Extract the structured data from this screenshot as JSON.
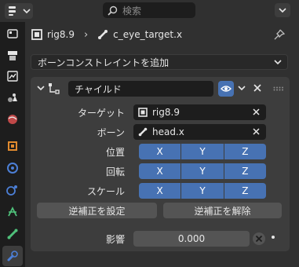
{
  "header": {
    "search_placeholder": "検索"
  },
  "breadcrumb": {
    "armature": "rig8.9",
    "bone": "c_eye_target.x"
  },
  "add_constraint_label": "ボーンコンストレイントを追加",
  "constraint": {
    "name": "チャイルド",
    "target_label": "ターゲット",
    "target_value": "rig8.9",
    "bone_label": "ボーン",
    "bone_value": "head.x",
    "location_label": "位置",
    "rotation_label": "回転",
    "scale_label": "スケール",
    "axes": [
      "X",
      "Y",
      "Z"
    ],
    "set_inverse_label": "逆補正を設定",
    "clear_inverse_label": "逆補正を解除",
    "influence_label": "影響",
    "influence_value": "0.000"
  },
  "colors": {
    "accent": "#4772b3",
    "background": "#303030",
    "panel": "#3d3d3d",
    "field": "#1d1d1d"
  },
  "icons": [
    "editor-type-icon",
    "search-icon",
    "menu-caret-icon",
    "tool-icon",
    "render-icon",
    "output-icon",
    "view-layer-icon",
    "scene-icon",
    "world-icon",
    "object-icon",
    "modifiers-icon",
    "particles-icon",
    "physics-icon",
    "object-constraint-icon",
    "bone-icon",
    "bone-constraint-icon",
    "armature-icon",
    "pin-icon",
    "eye-icon",
    "close-icon",
    "drag-grip-icon"
  ]
}
